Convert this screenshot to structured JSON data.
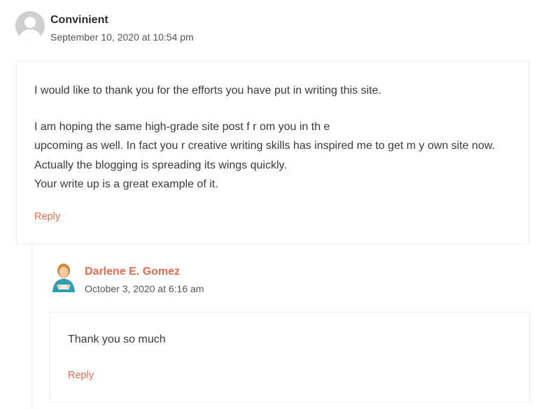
{
  "comments": [
    {
      "author": "Convinient",
      "date": "September 10, 2020 at 10:54 pm",
      "paragraphs": [
        "I would like to thank you for the efforts you have put in writing this site.",
        "I am hoping the same high-grade site post f r om you in th e",
        "upcoming as well. In fact you r  creative writing skills has inspired me to get m y  own site now.",
        "Actually the blogging is spreading its wings quickly.",
        "Your write up is a great example of it."
      ],
      "reply_label": "Reply",
      "avatar": "default-user-icon"
    },
    {
      "author": "Darlene E. Gomez",
      "date": "October 3, 2020 at 6:16 am",
      "text": "Thank you so much",
      "reply_label": "Reply",
      "avatar": "woman-avatar-icon"
    }
  ],
  "colors": {
    "accent": "#e46a4f",
    "text": "#3a3a3a",
    "border": "#ececec"
  }
}
